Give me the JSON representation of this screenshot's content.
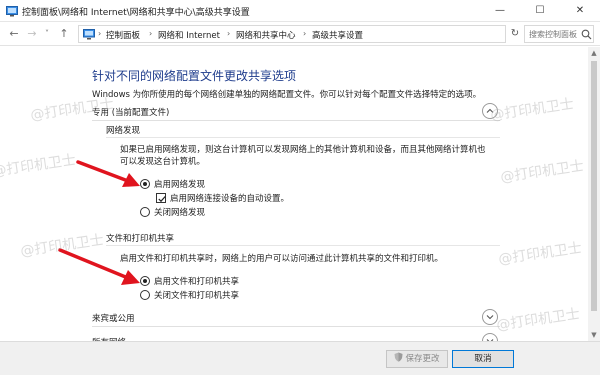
{
  "window": {
    "title": "控制面板\\网络和 Internet\\网络和共享中心\\高级共享设置",
    "min_glyph": "—",
    "max_glyph": "☐",
    "close_glyph": "✕"
  },
  "nav": {
    "back_glyph": "←",
    "forward_glyph": "→",
    "recent_glyph": "˅",
    "up_glyph": "↑",
    "breadcrumbs": [
      "控制面板",
      "网络和 Internet",
      "网络和共享中心",
      "高级共享设置"
    ],
    "crumb_sep": "›",
    "dropdown_glyph": "˅",
    "refresh_glyph": "↻",
    "search_placeholder": "搜索控制面板"
  },
  "main": {
    "title": "针对不同的网络配置文件更改共享选项",
    "description": "Windows 为你所使用的每个网络创建单独的网络配置文件。你可以针对每个配置文件选择特定的选项。",
    "profile_private": {
      "title": "专用 (当前配置文件)",
      "network_discovery": {
        "heading": "网络发现",
        "text_line1": "如果已启用网络发现，则这台计算机可以发现网络上的其他计算机和设备，而且其他网络计算机也",
        "text_line2": "可以发现这台计算机。",
        "opt_on": "启用网络发现",
        "opt_auto": "启用网络连接设备的自动设置。",
        "opt_off": "关闭网络发现"
      },
      "file_printer": {
        "heading": "文件和打印机共享",
        "text": "启用文件和打印机共享时，网络上的用户可以访问通过此计算机共享的文件和打印机。",
        "opt_on": "启用文件和打印机共享",
        "opt_off": "关闭文件和打印机共享"
      }
    },
    "profile_guest": {
      "title": "来宾或公用"
    },
    "profile_all": {
      "title": "所有网络"
    }
  },
  "footer": {
    "save_label": "保存更改",
    "cancel_label": "取消"
  },
  "watermark": "@打印机卫士",
  "colors": {
    "title_blue": "#1e3c8c",
    "arrow_red": "#e0141e",
    "accent": "#0078d7"
  }
}
